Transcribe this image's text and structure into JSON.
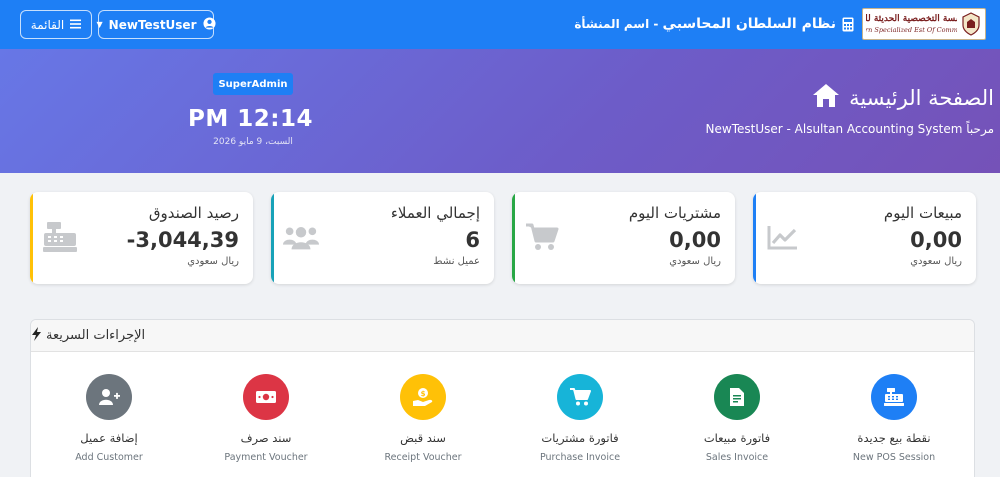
{
  "navbar": {
    "logo_ar": "المؤسسة التخصصية الحديثة للتجارة",
    "logo_en": "Modern Specialized Est Of Commercial",
    "system_name": "نظام السلطان المحاسبي",
    "separator": " - ",
    "org_label": "اسم المنشأة",
    "user_button": "NewTestUser",
    "menu_button": "القائمة"
  },
  "hero": {
    "title": "الصفحة الرئيسية",
    "welcome": "مرحباً NewTestUser - Alsultan Accounting System",
    "role_badge": "SuperAdmin",
    "clock": "12:14 PM",
    "date": "السبت، 9 مايو 2026"
  },
  "stats": [
    {
      "title": "مبيعات اليوم",
      "value": "0,00",
      "unit": "ريال سعودي",
      "icon": "chart-line-icon",
      "accent": "#1e7ff5"
    },
    {
      "title": "مشتريات اليوم",
      "value": "0,00",
      "unit": "ريال سعودي",
      "icon": "shopping-cart-icon",
      "accent": "#28a745"
    },
    {
      "title": "إجمالي العملاء",
      "value": "6",
      "unit": "عميل نشط",
      "icon": "users-icon",
      "accent": "#17a2b8"
    },
    {
      "title": "رصيد الصندوق",
      "value": "-3,044,39",
      "unit": "ريال سعودي",
      "icon": "cash-register-icon",
      "accent": "#ffc107"
    }
  ],
  "quick_actions": {
    "title": "الإجراءات السريعة",
    "items": [
      {
        "label_ar": "نقطة بيع جديدة",
        "label_en": "New POS Session",
        "color": "#1e7ff5",
        "icon": "cash-register-icon"
      },
      {
        "label_ar": "فاتورة مبيعات",
        "label_en": "Sales Invoice",
        "color": "#198754",
        "icon": "invoice-icon"
      },
      {
        "label_ar": "فاتورة مشتريات",
        "label_en": "Purchase Invoice",
        "color": "#17b4d8",
        "icon": "shopping-cart-icon"
      },
      {
        "label_ar": "سند قبض",
        "label_en": "Receipt Voucher",
        "color": "#ffc107",
        "icon": "hand-coin-icon"
      },
      {
        "label_ar": "سند صرف",
        "label_en": "Payment Voucher",
        "color": "#dc3545",
        "icon": "money-bill-icon"
      },
      {
        "label_ar": "إضافة عميل",
        "label_en": "Add Customer",
        "color": "#6c757d",
        "icon": "user-plus-icon"
      }
    ]
  }
}
